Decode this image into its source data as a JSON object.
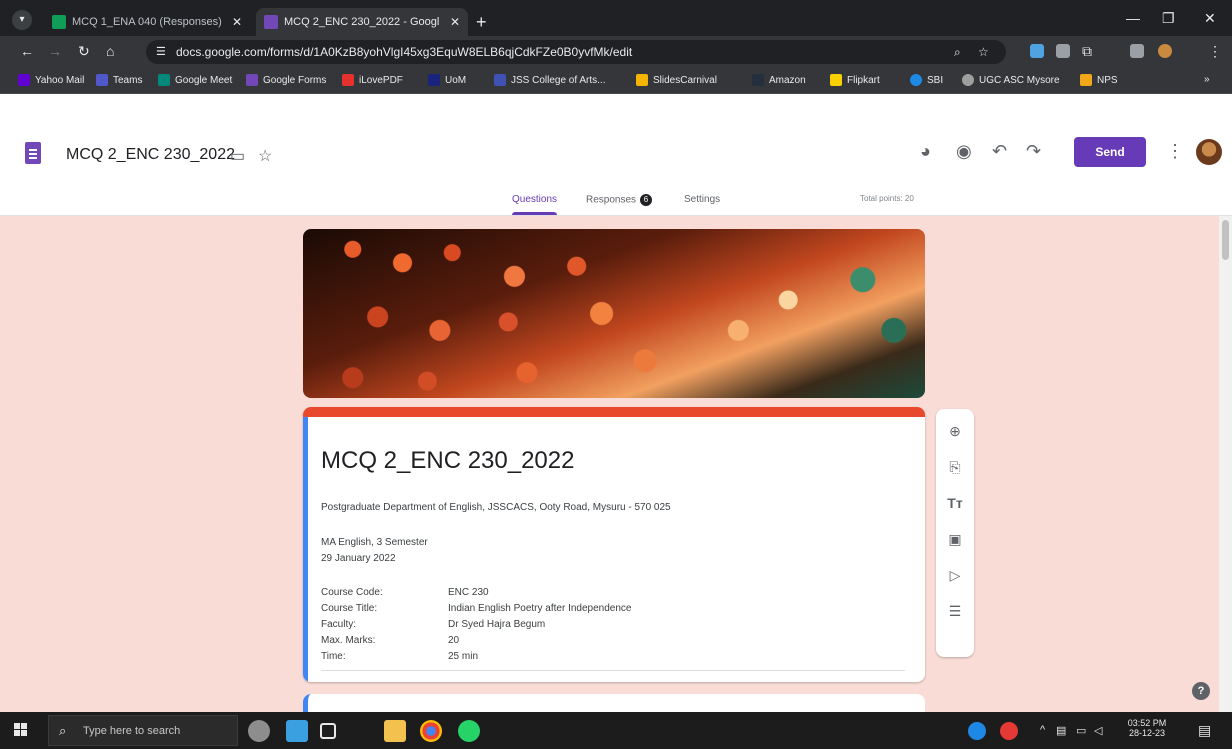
{
  "browser": {
    "tabs": [
      {
        "title": "MCQ 1_ENA 040 (Responses) -",
        "favicon_color": "#0f9d58",
        "active": false
      },
      {
        "title": "MCQ 2_ENC 230_2022 - Googl",
        "favicon_color": "#7248b9",
        "active": true
      }
    ],
    "new_tab_icon": "plus-icon",
    "url": "docs.google.com/forms/d/1A0KzB8yohVlgI45xg3EquW8ELB6qjCdkFZe0B0yvfMk/edit",
    "bookmarks": [
      {
        "label": "Yahoo Mail",
        "color": "#6001d2"
      },
      {
        "label": "Teams",
        "color": "#5059c9"
      },
      {
        "label": "Google Meet",
        "color": "#00897b"
      },
      {
        "label": "Google Forms",
        "color": "#7248b9"
      },
      {
        "label": "iLovePDF",
        "color": "#e5322d"
      },
      {
        "label": "UoM",
        "color": "#1a237e"
      },
      {
        "label": "JSS College of Arts...",
        "color": "#3f51b5"
      },
      {
        "label": "SlidesCarnival",
        "color": "#f4b400"
      },
      {
        "label": "Amazon",
        "color": "#232f3e"
      },
      {
        "label": "Flipkart",
        "color": "#f8d000"
      },
      {
        "label": "SBI",
        "color": "#1e88e5"
      },
      {
        "label": "UGC ASC Mysore",
        "color": "#9e9e9e"
      },
      {
        "label": "NPS",
        "color": "#f2a71b"
      }
    ],
    "more_bookmarks": "»"
  },
  "forms": {
    "doc_title": "MCQ 2_ENC 230_2022",
    "send_label": "Send",
    "tabs": {
      "questions": "Questions",
      "responses": "Responses",
      "responses_count": "6",
      "settings": "Settings"
    },
    "total_points": "Total points: 20",
    "accent_color": "#673ab7"
  },
  "card": {
    "heading": "MCQ 2_ENC 230_2022",
    "department": "Postgraduate Department of English, JSSCACS, Ooty Road, Mysuru - 570 025",
    "program": "MA English, 3 Semester",
    "date": "29 January 2022",
    "fields": [
      {
        "label": "Course Code:",
        "value": "ENC 230"
      },
      {
        "label": "Course Title:",
        "value": "Indian English Poetry after Independence"
      },
      {
        "label": "Faculty:",
        "value": "Dr Syed Hajra Begum"
      },
      {
        "label": "Max. Marks:",
        "value": "20"
      },
      {
        "label": "Time:",
        "value": "25 min"
      }
    ],
    "theme_color": "#e8482c"
  },
  "taskbar": {
    "search_placeholder": "Type here to search",
    "time": "03:52 PM",
    "date": "28-12-23"
  }
}
